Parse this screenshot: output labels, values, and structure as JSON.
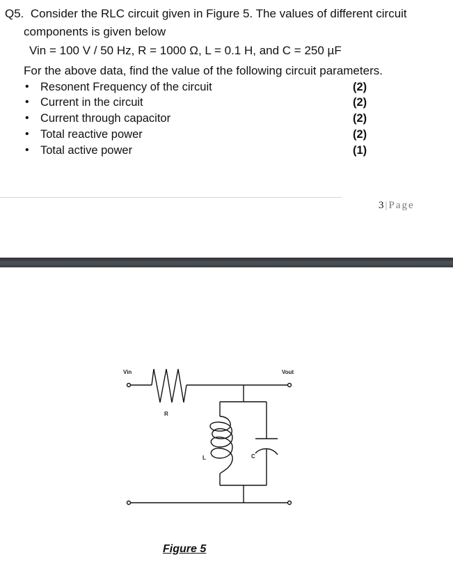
{
  "question": {
    "number": "Q5.",
    "line1": "Consider the RLC circuit given in Figure 5. The values of different circuit",
    "line2": "components is given below",
    "values_line": "Vin = 100 V / 50 Hz,  R = 1000 Ω, L = 0.1 H, and C = 250 µF",
    "instruction": "For the above data, find the value of the following circuit parameters.",
    "items": [
      {
        "label": "Resonent Frequency of the circuit",
        "marks": "(2)"
      },
      {
        "label": "Current in the circuit",
        "marks": "(2)"
      },
      {
        "label": "Current through capacitor",
        "marks": "(2)"
      },
      {
        "label": "Total reactive power",
        "marks": "(2)"
      },
      {
        "label": "Total active power",
        "marks": "(1)"
      }
    ],
    "bullet": "•"
  },
  "footer": {
    "page_number": "3",
    "separator": "|",
    "page_word": "Page"
  },
  "figure": {
    "labels": {
      "vin": "Vin",
      "vout": "Vout",
      "r": "R",
      "l": "L",
      "c": "C"
    },
    "caption": "Figure 5"
  }
}
